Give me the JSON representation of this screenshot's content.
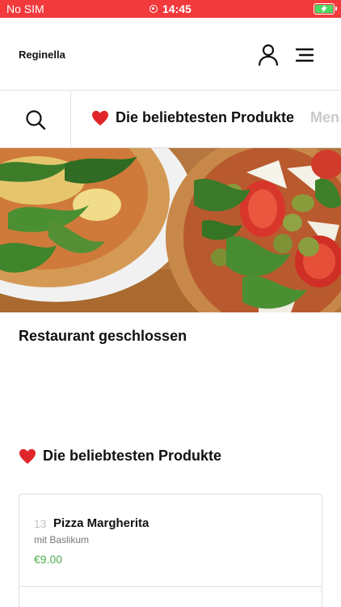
{
  "status_bar": {
    "carrier": "No SIM",
    "time": "14:45",
    "bar_color": "#f23a3c",
    "battery_color": "#4cd964"
  },
  "header": {
    "brand": "Reginella",
    "user_icon": "user-icon",
    "menu_icon": "hamburger-menu-icon"
  },
  "categories": {
    "search_icon": "search-icon",
    "tabs": [
      {
        "label": "Die beliebtesten Produkte",
        "icon": "heart-icon"
      },
      {
        "label": "Men"
      }
    ]
  },
  "hero": {
    "image": "pizza-photo"
  },
  "restaurant_status": "Restaurant geschlossen",
  "section": {
    "title": "Die beliebtesten Produkte",
    "icon": "heart-icon"
  },
  "products": [
    {
      "number": "13",
      "name": "Pizza Margherita",
      "description": "mit Baslikum",
      "price": "€9.00"
    }
  ],
  "colors": {
    "accent": "#f23a3c",
    "price": "#4caf50",
    "muted": "#c9c9c9"
  }
}
